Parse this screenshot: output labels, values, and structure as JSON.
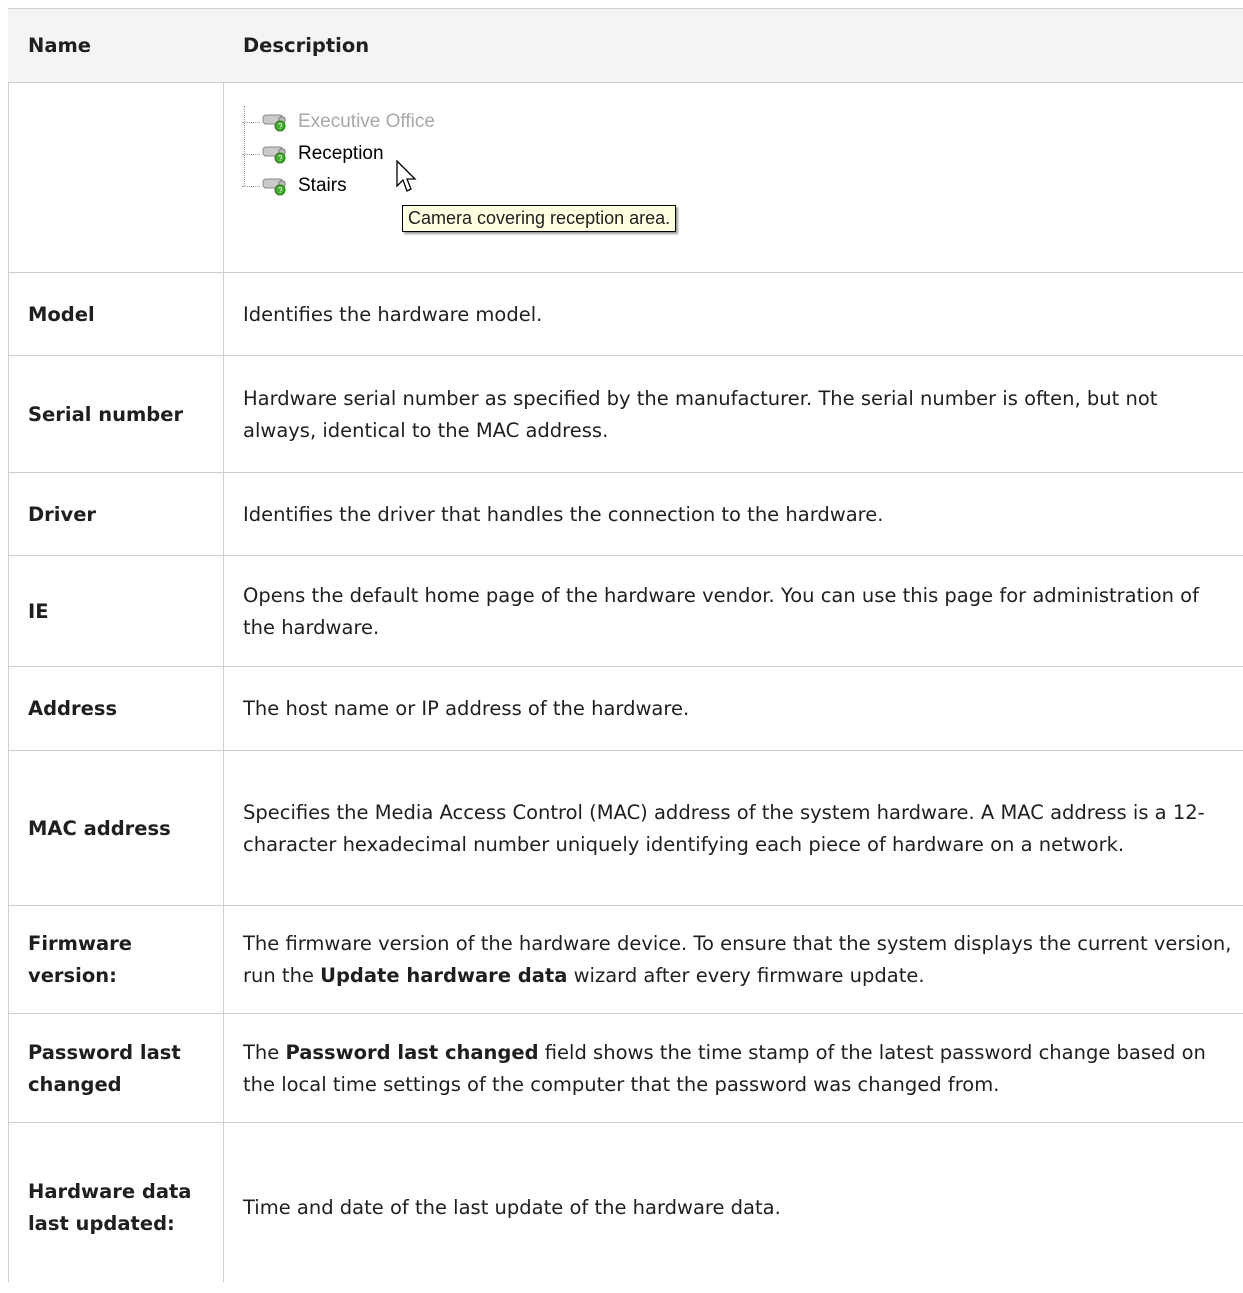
{
  "header": {
    "name": "Name",
    "description": "Description"
  },
  "screenshot": {
    "items": [
      "Executive Office",
      "Reception",
      "Stairs"
    ],
    "tooltip": "Camera covering reception area."
  },
  "rows": [
    {
      "name": "Model",
      "desc": "Identifies the hardware model."
    },
    {
      "name": "Serial number",
      "desc": "Hardware serial number as specified by the manufacturer. The serial number is often, but not always, identical to the MAC address."
    },
    {
      "name": "Driver",
      "desc": "Identifies the driver that handles the connection to the hardware."
    },
    {
      "name": "IE",
      "desc": "Opens the default home page of the hardware vendor. You can use this page for administration of the hardware."
    },
    {
      "name": "Address",
      "desc": "The host name or IP address of the hardware."
    },
    {
      "name": "MAC address",
      "desc": "Specifies the Media Access Control (MAC) address of the system hardware. A MAC address is a 12-character hexadecimal number uniquely identifying each piece of hardware on a network."
    },
    {
      "name": "Firmware version:",
      "desc_pre": "The firmware version of the hardware device. To ensure that the system displays the current version, run the ",
      "desc_bold": "Update hardware data",
      "desc_post": " wizard after every firmware update."
    },
    {
      "name": "Password last changed",
      "desc_pre": "The ",
      "desc_bold": "Password last changed",
      "desc_post": " field shows the time stamp of the latest password change based on the local time settings of the computer that the password was changed from."
    },
    {
      "name": "Hardware data last updated:",
      "desc": "Time and date of the last update of the hardware data."
    }
  ]
}
